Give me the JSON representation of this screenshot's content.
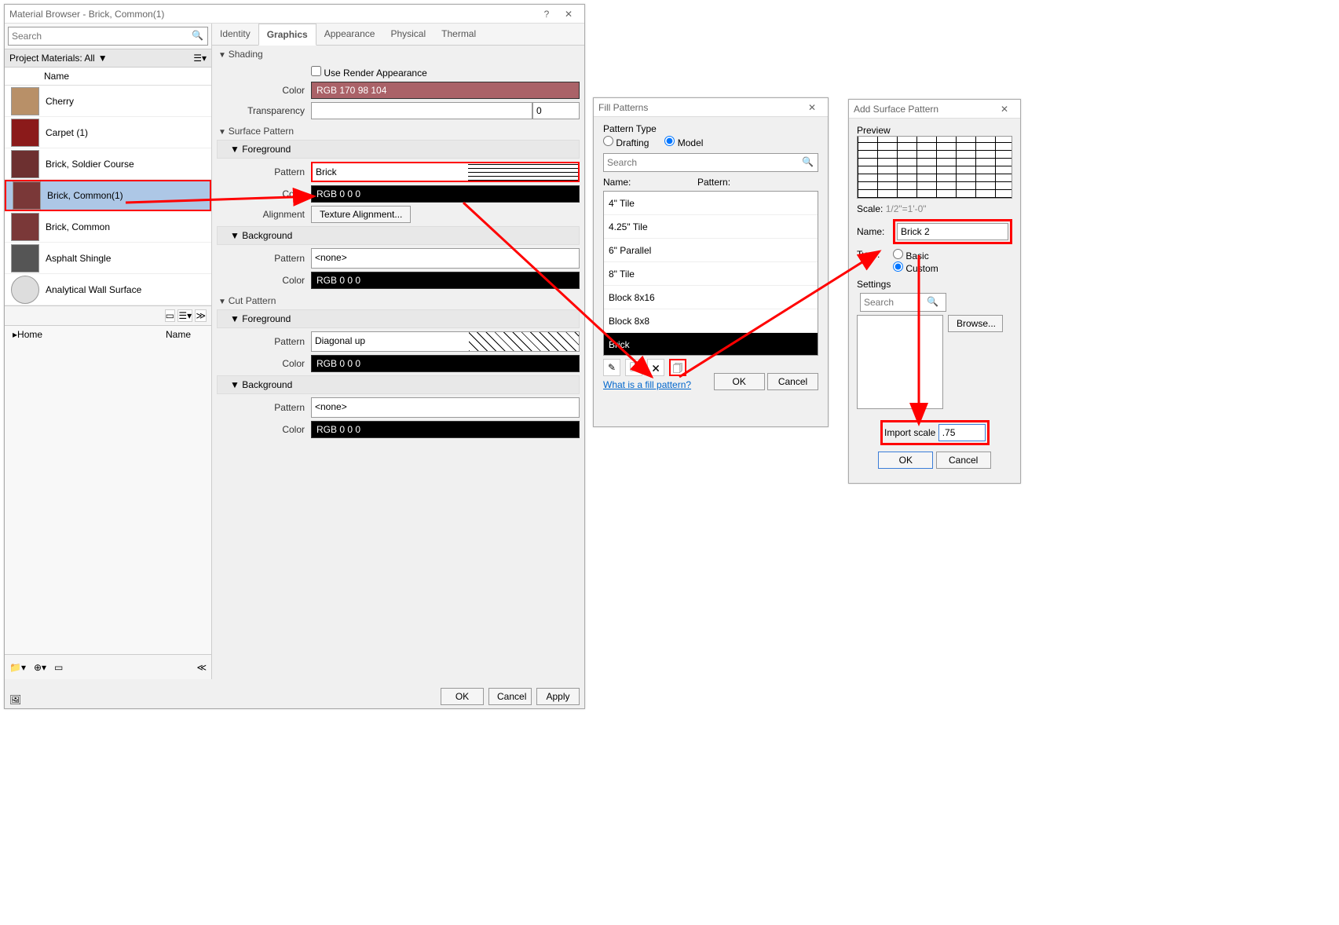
{
  "mb": {
    "title": "Material Browser - Brick, Common(1)",
    "search_ph": "Search",
    "proj_hdr": "Project Materials: All",
    "name_col": "Name",
    "materials": [
      {
        "name": "Cherry"
      },
      {
        "name": "Carpet (1)"
      },
      {
        "name": "Brick, Soldier Course"
      },
      {
        "name": "Brick, Common(1)",
        "sel": true
      },
      {
        "name": "Brick, Common"
      },
      {
        "name": "Asphalt Shingle"
      },
      {
        "name": "Analytical Wall Surface"
      }
    ],
    "home": "Home",
    "name2": "Name",
    "tabs": {
      "identity": "Identity",
      "graphics": "Graphics",
      "appearance": "Appearance",
      "physical": "Physical",
      "thermal": "Thermal"
    },
    "shading": {
      "hdr": "Shading",
      "use_render": "Use Render Appearance",
      "color_lbl": "Color",
      "color_val": "RGB 170 98 104",
      "trans_lbl": "Transparency",
      "trans_val": "0"
    },
    "surface": {
      "hdr": "Surface Pattern",
      "fg": "Foreground",
      "bg": "Background",
      "pattern_lbl": "Pattern",
      "fg_pattern": "Brick",
      "color_lbl": "Color",
      "rgb000": "RGB 0 0 0",
      "align_lbl": "Alignment",
      "align_btn": "Texture Alignment...",
      "bg_pattern": "<none>"
    },
    "cut": {
      "hdr": "Cut Pattern",
      "fg": "Foreground",
      "bg": "Background",
      "fg_pattern": "Diagonal up",
      "bg_pattern": "<none>"
    },
    "footer": {
      "ok": "OK",
      "cancel": "Cancel",
      "apply": "Apply"
    }
  },
  "fp": {
    "title": "Fill Patterns",
    "type_lbl": "Pattern Type",
    "drafting": "Drafting",
    "model": "Model",
    "search_ph": "Search",
    "name_lbl": "Name:",
    "pattern_lbl": "Pattern:",
    "patterns": [
      "4\" Tile",
      "4.25\" Tile",
      "6\" Parallel",
      "8\" Tile",
      "Block 8x16",
      "Block 8x8",
      "Brick"
    ],
    "link": "What is a fill pattern?",
    "ok": "OK",
    "cancel": "Cancel"
  },
  "asp": {
    "title": "Add Surface Pattern",
    "preview_lbl": "Preview",
    "scale_lbl": "Scale:",
    "scale_val": "1/2\"=1'-0\"",
    "name_lbl": "Name:",
    "name_val": "Brick 2",
    "type_lbl": "Type:",
    "basic": "Basic",
    "custom": "Custom",
    "settings_lbl": "Settings",
    "search_ph": "Search",
    "browse": "Browse...",
    "import_lbl": "Import scale",
    "import_val": ".75",
    "ok": "OK",
    "cancel": "Cancel"
  }
}
